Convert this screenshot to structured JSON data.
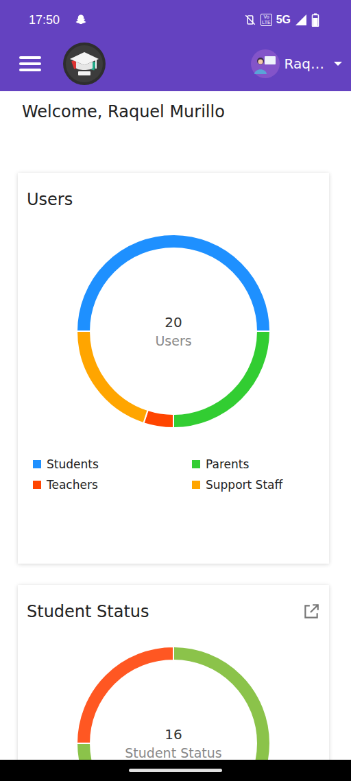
{
  "status_bar": {
    "time": "17:50",
    "volte": [
      "Vo",
      "LTE"
    ],
    "network": "5G",
    "battery": {
      "level": 0.8
    }
  },
  "app_bar": {
    "user": "Raq…"
  },
  "welcome": "Welcome, Raquel Murillo",
  "cards": [
    {
      "title": "Users",
      "external_link": false,
      "total": "20",
      "total_label": "Users",
      "series": [
        {
          "label": "Students",
          "value": 10,
          "color": "#1e90ff"
        },
        {
          "label": "Parents",
          "value": 5,
          "color": "#32cd32"
        },
        {
          "label": "Teachers",
          "value": 1,
          "color": "#ff4500"
        },
        {
          "label": "Support Staff",
          "value": 4,
          "color": "#ffa500"
        }
      ]
    },
    {
      "title": "Student Status",
      "external_link": true,
      "total": "16",
      "total_label": "Student Status",
      "series": [
        {
          "value": 12,
          "color": "#8bc34a"
        },
        {
          "value": 4,
          "color": "#ff5722"
        }
      ]
    }
  ]
}
